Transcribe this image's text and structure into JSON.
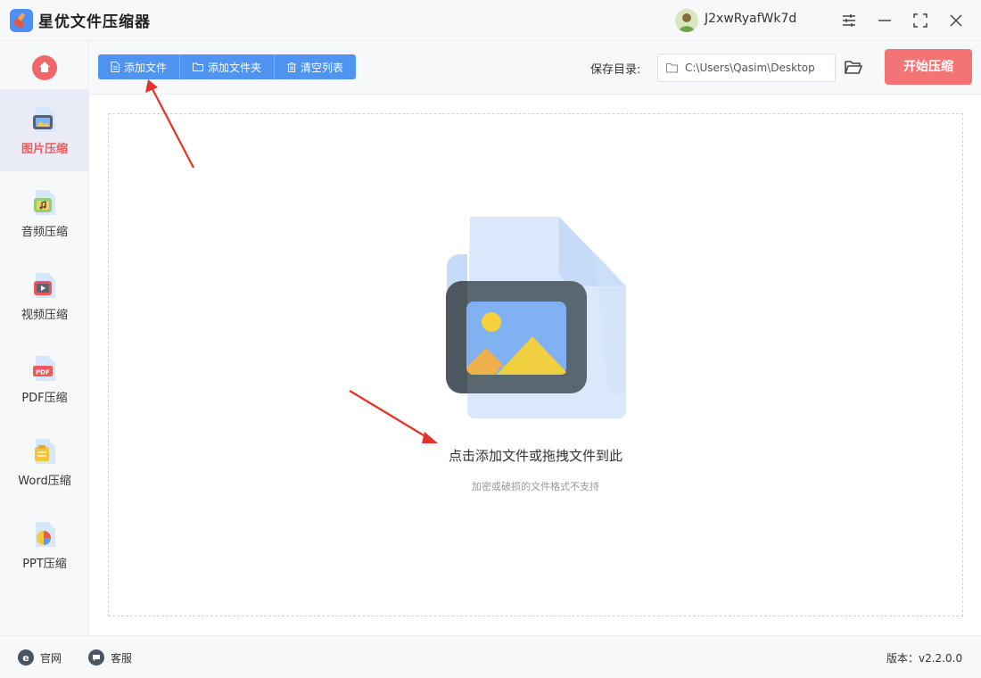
{
  "app": {
    "title": "星优文件压缩器",
    "username": "J2xwRyafWk7d"
  },
  "sidebar": {
    "items": [
      {
        "label": "图片压缩",
        "icon": "image-file-icon",
        "active": true
      },
      {
        "label": "音频压缩",
        "icon": "audio-file-icon",
        "active": false
      },
      {
        "label": "视频压缩",
        "icon": "video-file-icon",
        "active": false
      },
      {
        "label": "PDF压缩",
        "icon": "pdf-file-icon",
        "active": false
      },
      {
        "label": "Word压缩",
        "icon": "word-file-icon",
        "active": false
      },
      {
        "label": "PPT压缩",
        "icon": "ppt-file-icon",
        "active": false
      }
    ]
  },
  "toolbar": {
    "add_file": "添加文件",
    "add_folder": "添加文件夹",
    "clear_list": "清空列表",
    "save_label": "保存目录:",
    "save_path": "C:\\Users\\Qasim\\Desktop",
    "start": "开始压缩"
  },
  "dropzone": {
    "title": "点击添加文件或拖拽文件到此",
    "subtitle": "加密或破损的文件格式不支持"
  },
  "footer": {
    "website": "官网",
    "support": "客服",
    "version": "版本：v2.2.0.0"
  },
  "colors": {
    "primary": "#4f94f0",
    "accent": "#f47374",
    "active_text": "#f05b5b"
  }
}
